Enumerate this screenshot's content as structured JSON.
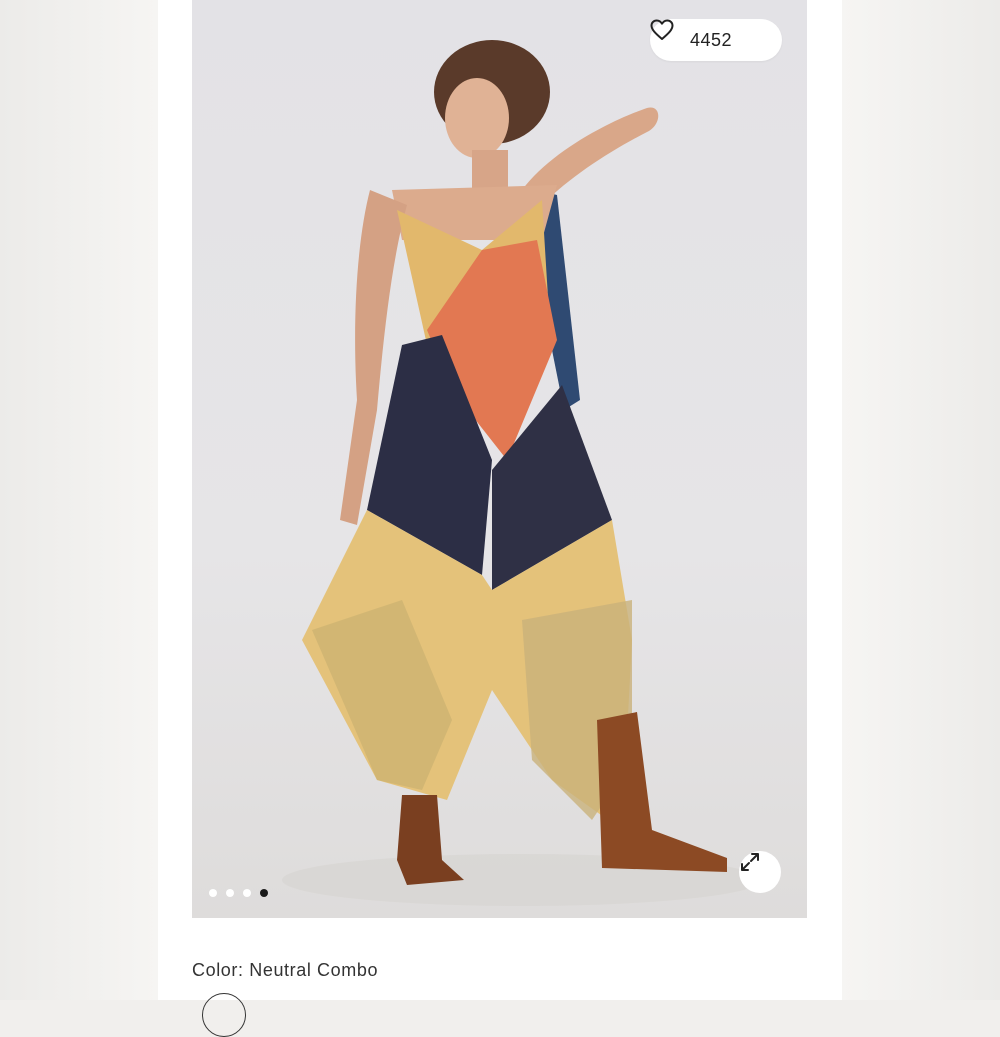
{
  "product": {
    "favorite_count": "4452",
    "color_label": "Color:",
    "color_value": "Neutral Combo"
  },
  "gallery": {
    "image_count": 4,
    "active_index": 3
  },
  "icons": {
    "favorite": "heart-icon",
    "expand": "expand-arrows-icon"
  },
  "colors": {
    "background": "#f1efed",
    "panel": "#ffffff",
    "text": "#333333",
    "dot_active": "#1a1a1a"
  }
}
